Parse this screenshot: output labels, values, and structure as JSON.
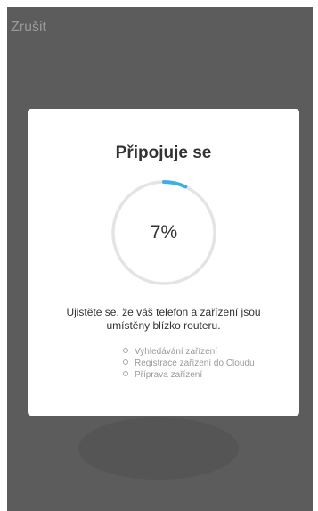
{
  "header": {
    "cancel_label": "Zrušit"
  },
  "dialog": {
    "title": "Připojuje se",
    "progress": {
      "percent_text": "7%",
      "value": 0.07,
      "track_color": "#e4e4e4",
      "fill_color": "#3ab0e6"
    },
    "message": "Ujistěte se, že váš telefon a zařízení jsou umístěny blízko routeru.",
    "steps": [
      {
        "label": "Vyhledávání zařízení"
      },
      {
        "label": "Registrace zařízení do Cloudu"
      },
      {
        "label": "Příprava zařízení"
      }
    ]
  }
}
